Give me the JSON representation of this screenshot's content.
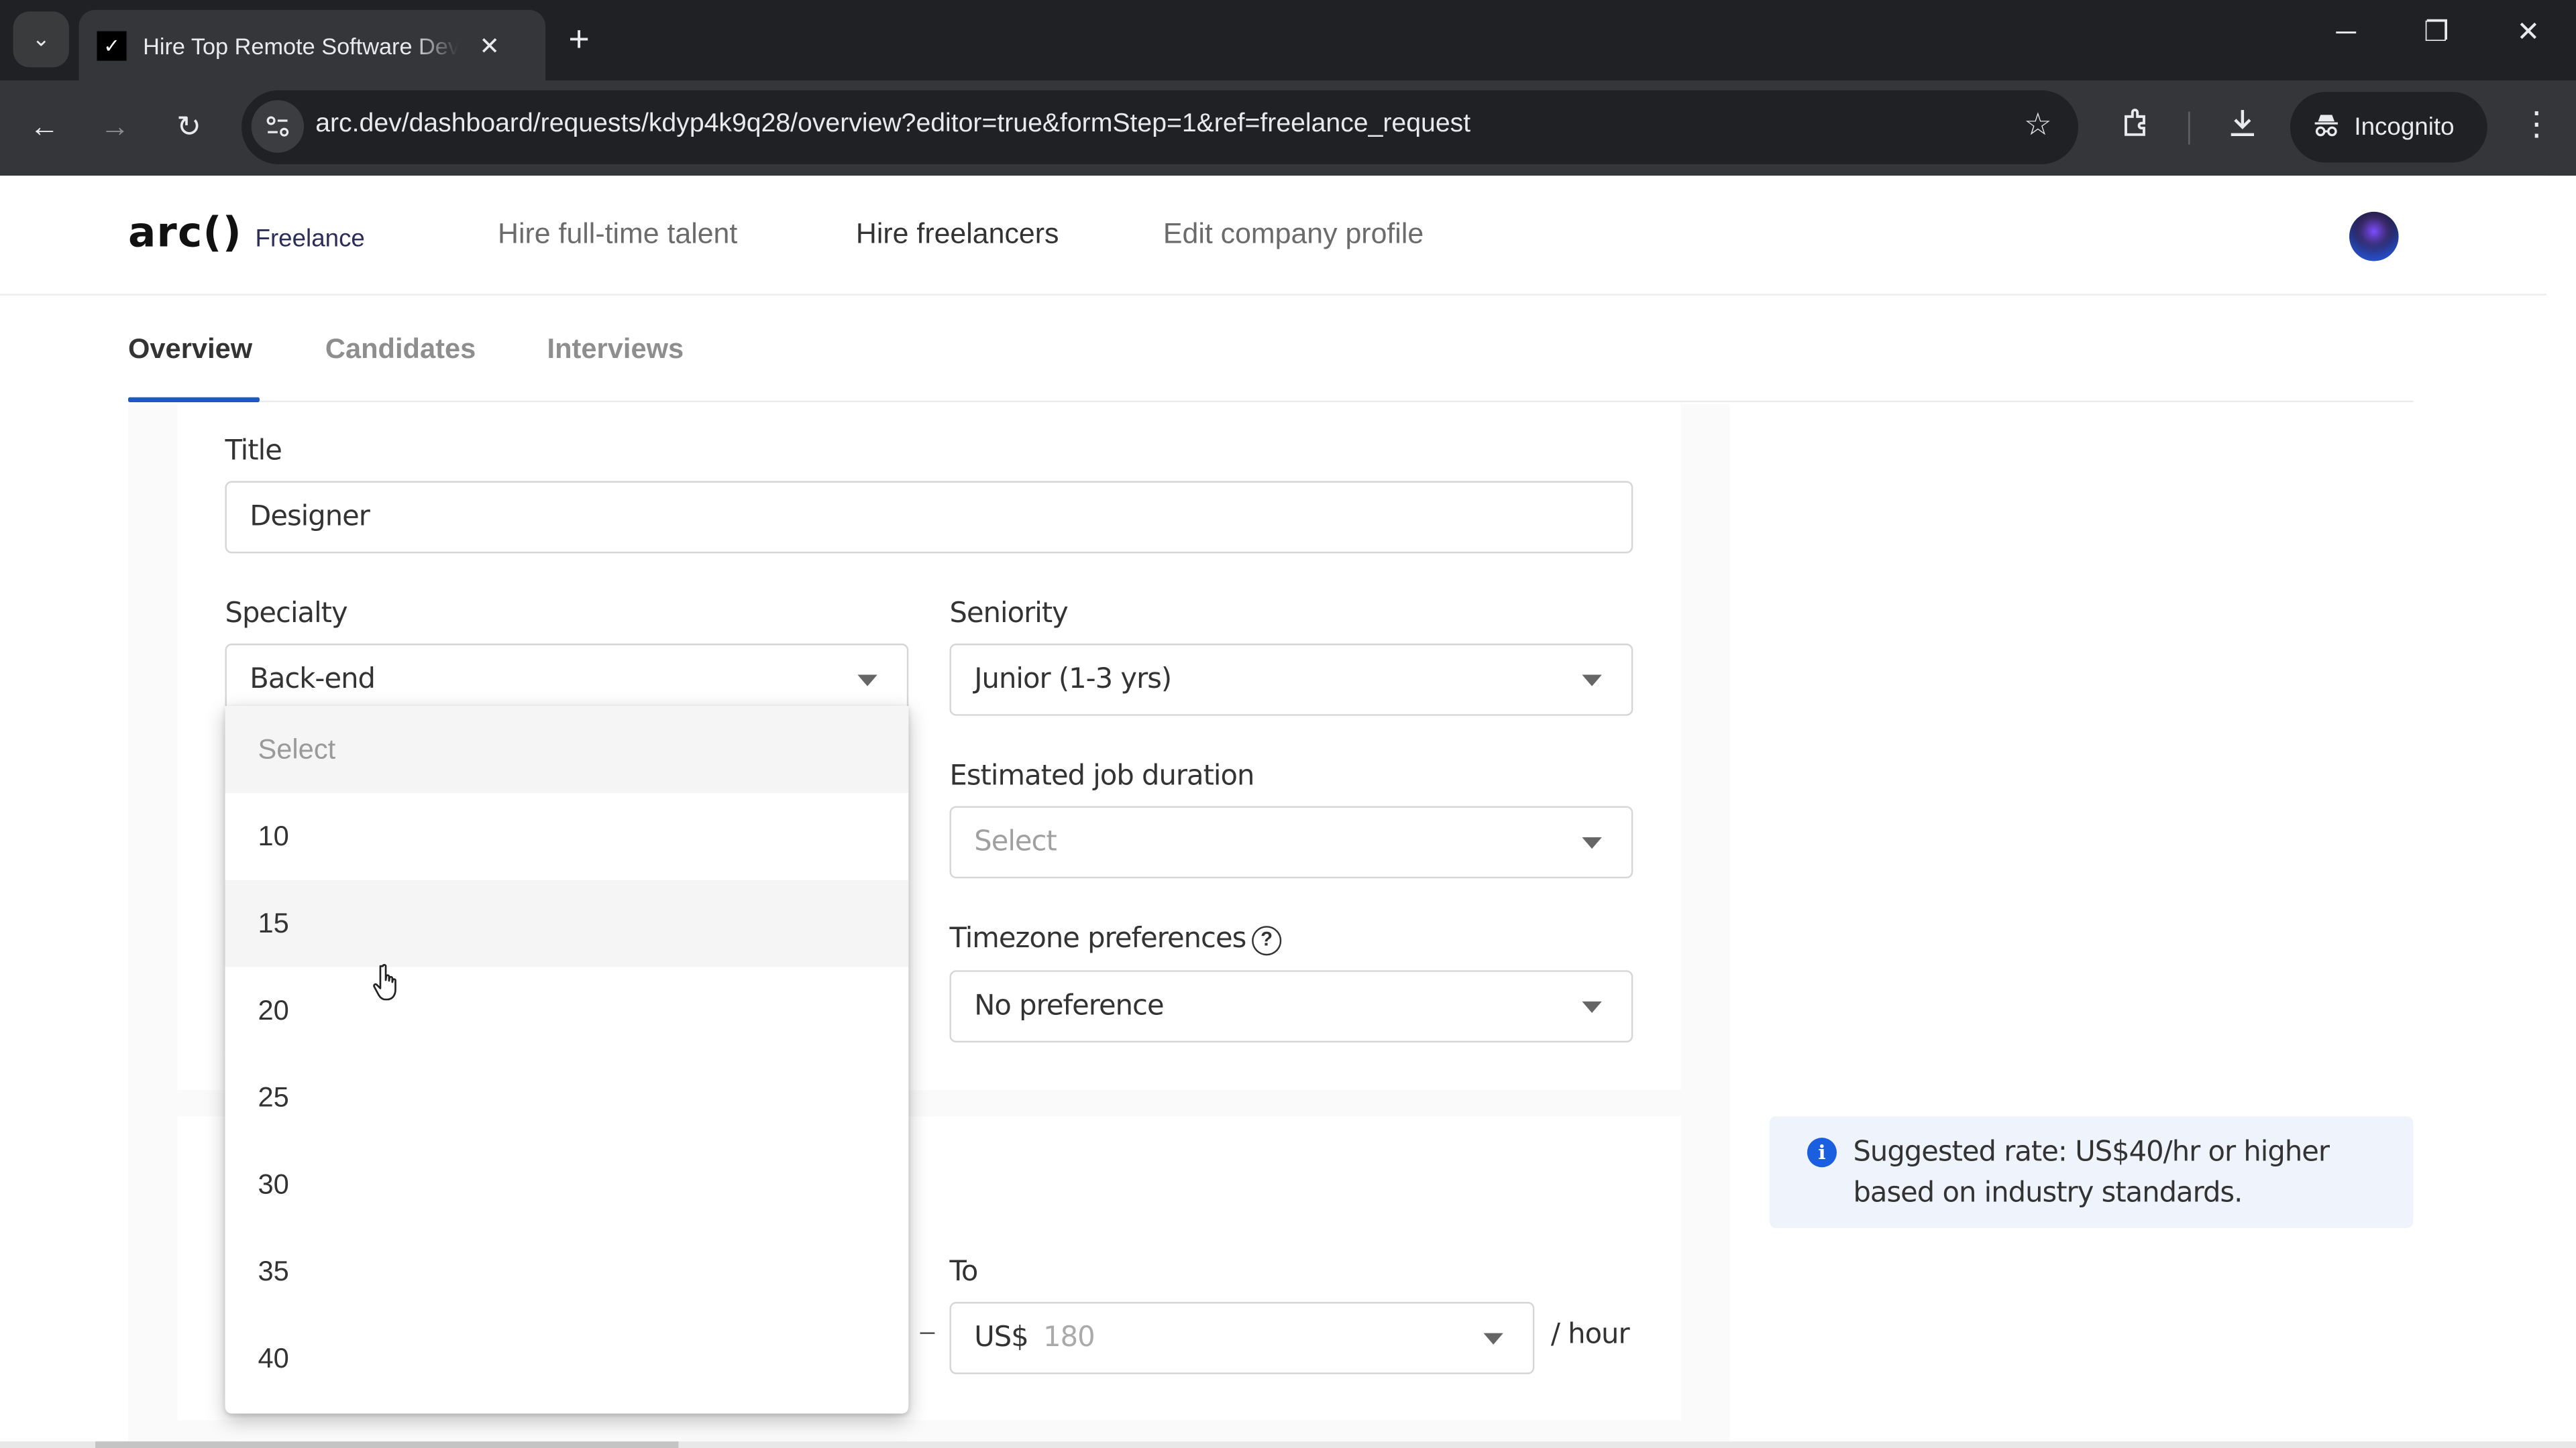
{
  "browser": {
    "tab_title": "Hire Top Remote Software Developers",
    "tab_favicon": "arc-checkmark",
    "url": "arc.dev/dashboard/requests/kdyp4k9q28/overview?editor=true&formStep=1&ref=freelance_request",
    "profile_label": "Incognito",
    "icons": {
      "tab_search": "⌄",
      "tab_close": "✕",
      "new_tab": "+",
      "minimize": "─",
      "restore": "❐",
      "close": "✕",
      "back": "←",
      "forward": "→",
      "reload": "↻",
      "site_info": "⚙",
      "bookmark": "☆",
      "extensions": "⧉",
      "download": "⤓",
      "incognito": "🕶",
      "menu": "⋮"
    }
  },
  "header": {
    "logo": "arc()",
    "logo_sub": "Freelance",
    "nav": [
      {
        "label": "Hire full-time talent",
        "active": false
      },
      {
        "label": "Hire freelancers",
        "active": true
      },
      {
        "label": "Edit company profile",
        "active": false
      }
    ]
  },
  "subtabs": [
    {
      "label": "Overview",
      "active": true
    },
    {
      "label": "Candidates",
      "active": false
    },
    {
      "label": "Interviews",
      "active": false
    }
  ],
  "form": {
    "title": {
      "label": "Title",
      "value": "Designer"
    },
    "specialty": {
      "label": "Specialty",
      "value": "Back-end"
    },
    "seniority": {
      "label": "Seniority",
      "value": "Junior (1-3 yrs)"
    },
    "duration": {
      "label": "Estimated job duration",
      "placeholder": "Select"
    },
    "timezone": {
      "label": "Timezone preferences",
      "value": "No preference",
      "help_icon": "?"
    },
    "rate_to": {
      "label": "To",
      "currency": "US$",
      "placeholder": "180"
    },
    "range_separator": "–",
    "per_unit": "/ hour"
  },
  "dropdown": {
    "options": [
      "Select",
      "10",
      "15",
      "20",
      "25",
      "30",
      "35",
      "40"
    ],
    "hovered": "15"
  },
  "info": {
    "icon": "i",
    "text": "Suggested rate: US$40/hr or higher based on industry standards."
  },
  "colors": {
    "accent": "#1f57c3",
    "info_bg": "#eef3fc",
    "info_icon": "#1a5fe0",
    "logo_sub": "#2b2d5a"
  }
}
